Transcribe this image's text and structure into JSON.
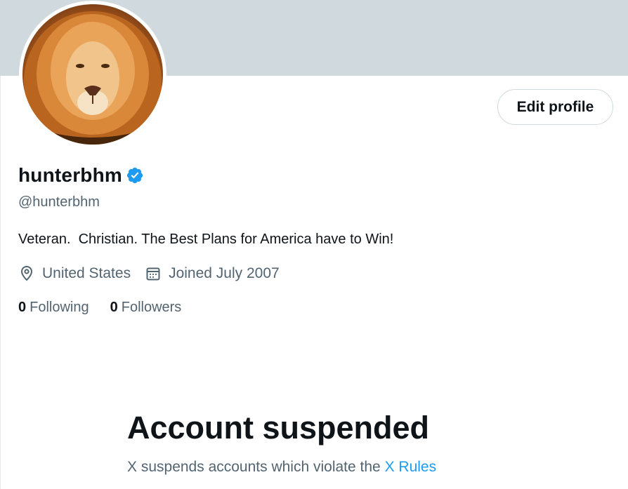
{
  "profile": {
    "display_name": "hunterbhm",
    "handle": "@hunterbhm",
    "bio": "Veteran.  Christian. The Best Plans for America have to Win!",
    "location": "United States",
    "joined": "Joined July 2007",
    "following_count": "0",
    "following_label": "Following",
    "followers_count": "0",
    "followers_label": "Followers",
    "edit_button_label": "Edit profile"
  },
  "suspension": {
    "title": "Account suspended",
    "message": "X suspends accounts which violate the",
    "rules_link": "X Rules"
  },
  "colors": {
    "banner": "#cfd9de",
    "text_primary": "#0f1419",
    "text_secondary": "#536471",
    "accent": "#1d9bf0"
  },
  "icons": {
    "verified": "verified-badge-icon",
    "location": "location-pin-icon",
    "joined": "calendar-icon"
  }
}
